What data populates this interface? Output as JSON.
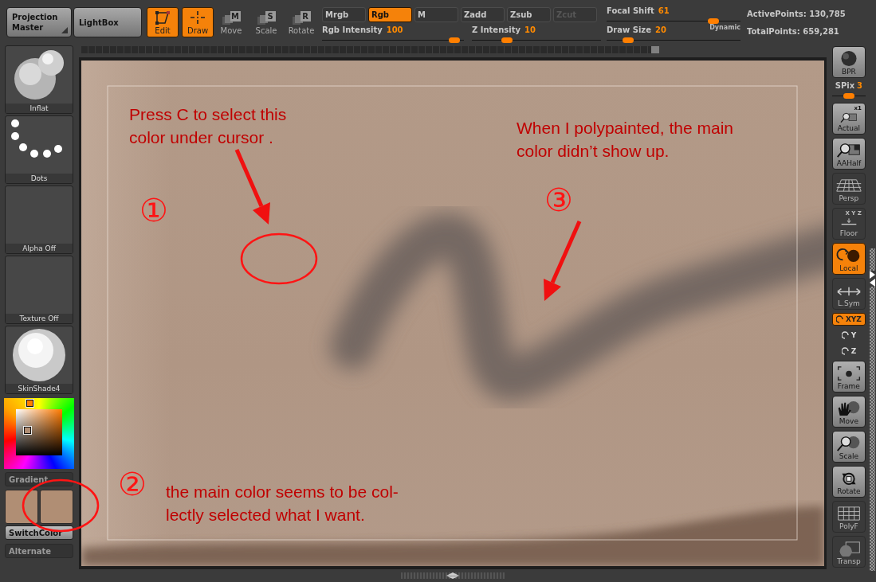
{
  "top_bar": {
    "buttons": [
      {
        "label": "Projection Master",
        "kind": "menu"
      },
      {
        "label": "LightBox",
        "kind": "plain"
      }
    ],
    "tools": [
      {
        "label": "Edit",
        "selected": true
      },
      {
        "label": "Draw",
        "selected": true
      },
      {
        "label": "Move",
        "key": "M",
        "selected": false
      },
      {
        "label": "Scale",
        "key": "S",
        "selected": false
      },
      {
        "label": "Rotate",
        "key": "R",
        "selected": false
      }
    ],
    "modes": [
      {
        "label": "Mrgb",
        "selected": false,
        "disabled": false
      },
      {
        "label": "Rgb",
        "selected": true,
        "disabled": false
      },
      {
        "label": "M",
        "selected": false,
        "disabled": false
      },
      {
        "label": "Zadd",
        "selected": false,
        "disabled": false
      },
      {
        "label": "Zsub",
        "selected": false,
        "disabled": false
      },
      {
        "label": "Zcut",
        "selected": false,
        "disabled": true
      }
    ],
    "sliders": [
      {
        "label": "Rgb Intensity",
        "reading": "100",
        "level": 0.93
      },
      {
        "label": "Z Intensity",
        "reading": "10",
        "level": 0.27
      },
      {
        "label": "Focal Shift",
        "reading": "61",
        "level": 0.8
      },
      {
        "label": "Draw Size",
        "reading": "20",
        "level": 0.16
      }
    ],
    "dynamic": "Dynamic",
    "stats": [
      "ActivePoints: 130,785",
      "TotalPoints: 659,281"
    ]
  },
  "left_panel": {
    "tiles": [
      {
        "label": "Inflat",
        "kind": "brush"
      },
      {
        "label": "Dots",
        "kind": "stroke"
      },
      {
        "label": "Alpha Off",
        "kind": "alpha"
      },
      {
        "label": "Texture Off",
        "kind": "texture"
      },
      {
        "label": "SkinShade4",
        "kind": "material"
      }
    ],
    "gradient": "Gradient",
    "swatches": [
      {
        "color": "#b08e74"
      },
      {
        "color": "#b08e74"
      }
    ],
    "switch_color": "SwitchColor",
    "alternate": "Alternate"
  },
  "shelf": {
    "items": [
      {
        "label": "BPR",
        "kind": "light",
        "selected": false
      },
      {
        "label": "SPix",
        "kind": "slider",
        "reading": "3",
        "level": 0.5
      },
      {
        "label": "Actual",
        "kind": "light",
        "selected": false,
        "caption": "x1"
      },
      {
        "label": "AAHalf",
        "kind": "light",
        "selected": false
      },
      {
        "label": "Persp",
        "kind": "dark",
        "selected": false
      },
      {
        "label": "Floor",
        "kind": "dark",
        "selected": false,
        "caption": "X Y Z"
      },
      {
        "label": "Local",
        "kind": "dark",
        "selected": true
      },
      {
        "label": "L.Sym",
        "kind": "dark",
        "selected": false
      },
      {
        "label": "XYZ",
        "kind": "small",
        "selected": true
      },
      {
        "label": "Y",
        "kind": "small",
        "selected": false
      },
      {
        "label": "Z",
        "kind": "small",
        "selected": false
      },
      {
        "label": "Frame",
        "kind": "light",
        "selected": false
      },
      {
        "label": "Move",
        "kind": "light",
        "selected": false
      },
      {
        "label": "Scale",
        "kind": "light",
        "selected": false
      },
      {
        "label": "Rotate",
        "kind": "light",
        "selected": false
      },
      {
        "label": "PolyF",
        "kind": "dark",
        "selected": false
      },
      {
        "label": "Transp",
        "kind": "dark",
        "selected": false
      }
    ]
  },
  "annotations": [
    {
      "kind": "note",
      "text": "Press C to select this\ncolor under cursor ."
    },
    {
      "kind": "note",
      "text": "When I polypainted, the main\ncolor didn’t show up."
    },
    {
      "kind": "number",
      "text": "③"
    },
    {
      "kind": "number",
      "text": "①"
    },
    {
      "kind": "number",
      "text": "②"
    },
    {
      "kind": "note",
      "text": "the main color seems to be col-\nlectly selected what I want."
    }
  ]
}
